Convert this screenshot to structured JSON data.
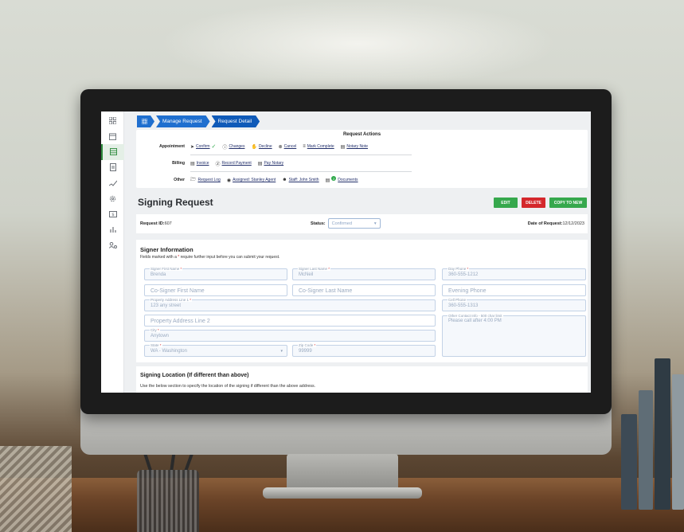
{
  "breadcrumb": {
    "items": [
      "Manage Request",
      "Request Detail"
    ]
  },
  "actions": {
    "title": "Request Actions",
    "appointment": {
      "label": "Appointment",
      "items": [
        "Confirm",
        "Changes",
        "Decline",
        "Cancel",
        "Mark Complete",
        "Notary Note"
      ]
    },
    "billing": {
      "label": "Billing",
      "items": [
        "Invoice",
        "Record Payment",
        "Pay Notary"
      ]
    },
    "other": {
      "label": "Other",
      "items": [
        "Request Log",
        "Assigned: Stanley Agent",
        "Staff: John Smith",
        "Documents"
      ],
      "documents_count": "2"
    }
  },
  "page": {
    "title": "Signing Request",
    "buttons": {
      "edit": "EDIT",
      "delete": "DELETE",
      "copy": "COPY TO NEW"
    }
  },
  "info": {
    "request_id_label": "Request ID:",
    "request_id": "607",
    "status_label": "Status:",
    "status_value": "Confirmed",
    "date_label": "Date of Request:",
    "date_value": "12/12/2023"
  },
  "signer": {
    "title": "Signer Information",
    "subtitle_pre": "Fields marked with a",
    "subtitle_star": "*",
    "subtitle_post": "require further input before you can submit your request.",
    "fields": {
      "first_name": {
        "label": "Signer First Name",
        "value": "Brenda"
      },
      "last_name": {
        "label": "Signer Last Name",
        "value": "McNeil"
      },
      "day_phone": {
        "label": "Day Phone",
        "value": "360-555-1212"
      },
      "cosigner_first": {
        "placeholder": "Co-Signer First Name"
      },
      "cosigner_last": {
        "placeholder": "Co-Signer Last Name"
      },
      "evening_phone": {
        "placeholder": "Evening Phone"
      },
      "address1": {
        "label": "Property Address Line 1",
        "value": "123 any street"
      },
      "cell_phone": {
        "label": "Cell Phone",
        "value": "360-555-1313"
      },
      "address2": {
        "placeholder": "Property Address Line 2"
      },
      "other_contact": {
        "label": "Other Contact Info - 500 char limit",
        "value": "Please call after 4:00 PM"
      },
      "city": {
        "label": "City",
        "value": "Anytown"
      },
      "state": {
        "label": "State",
        "value": "WA - Washington"
      },
      "zip": {
        "label": "Zip Code",
        "value": "99999"
      }
    }
  },
  "location": {
    "title": "Signing Location (If different than above)",
    "subtitle": "Use the below section to specify the location of the signing if different than the above address."
  },
  "colors": {
    "breadcrumb": "#1f6fcf",
    "edit": "#36a84d",
    "delete": "#d4282c",
    "copy": "#36a84d",
    "sidebar_active": "#2e8b3d"
  },
  "sidebar": {
    "icons": [
      "dashboard-icon",
      "calendar-icon",
      "list-icon",
      "document-icon",
      "signature-icon",
      "settings-icon",
      "dollar-icon",
      "reports-icon",
      "users-icon"
    ]
  }
}
